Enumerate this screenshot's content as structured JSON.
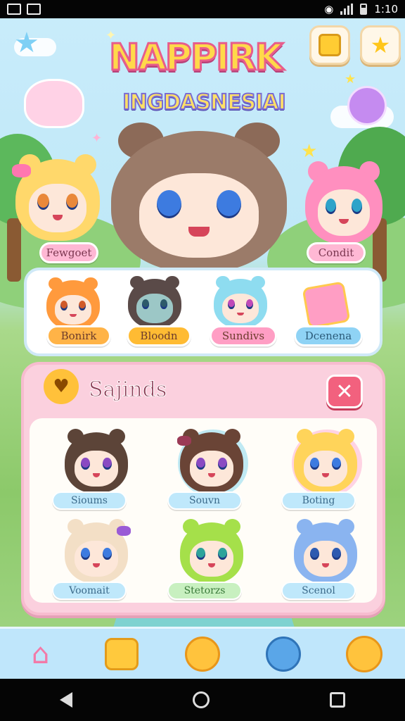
{
  "status_bar": {
    "time": "1:10"
  },
  "game": {
    "title_line1": "NAPPIRK",
    "title_line2": "INGDASNESIAI"
  },
  "top_buttons": [
    {
      "icon": "scroll-icon"
    },
    {
      "icon": "star-icon"
    }
  ],
  "hero_tags": {
    "left": "Fewgoet",
    "right": "Condit"
  },
  "roster": [
    {
      "label": "Bonirk",
      "color": "#ffb347"
    },
    {
      "label": "Bloodn",
      "color": "#ffbb33"
    },
    {
      "label": "Sundivs",
      "color": "#ff9ec4"
    },
    {
      "label": "Dcenena",
      "color": "#8fd3f5"
    }
  ],
  "dialog": {
    "title": "Sajinds",
    "close_label": "✕",
    "slots": [
      {
        "label": "Sioums"
      },
      {
        "label": "Souvn"
      },
      {
        "label": "Boting"
      },
      {
        "label": "Voomait"
      },
      {
        "label": "Stetorzs"
      },
      {
        "label": "Scenol"
      }
    ]
  },
  "bottom_nav": [
    {
      "icon": "home-icon"
    },
    {
      "icon": "cat-face-icon"
    },
    {
      "icon": "chick-icon"
    },
    {
      "icon": "blue-creature-icon"
    },
    {
      "icon": "smile-icon"
    }
  ],
  "colors": {
    "accent_pink": "#f2617e",
    "dialog_bg": "#fbd0de",
    "nav_bg": "#bfe6fb"
  }
}
